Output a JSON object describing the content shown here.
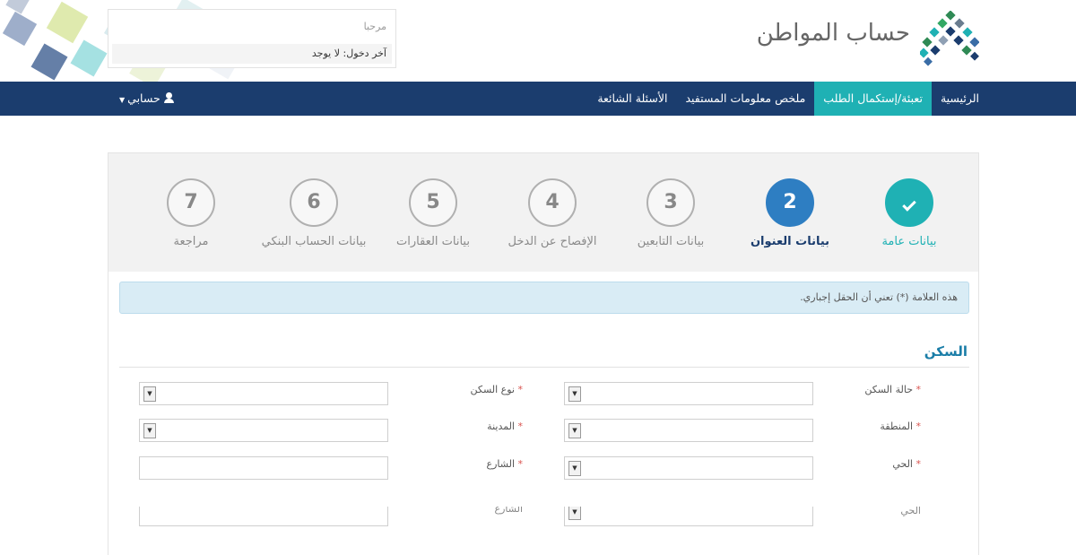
{
  "header": {
    "welcome": "مرحبا",
    "last_login": "آخر دخول: لا يوجد",
    "brand": "حساب المواطن"
  },
  "nav": {
    "items": [
      {
        "label": "الرئيسية",
        "active": false
      },
      {
        "label": "تعبئة/إستكمال الطلب",
        "active": true
      },
      {
        "label": "ملخص معلومات المستفيد",
        "active": false
      },
      {
        "label": "الأسئلة الشائعة",
        "active": false
      }
    ],
    "account_label": "حسابي",
    "account_caret": "▼"
  },
  "steps": [
    {
      "number": "",
      "label": "بيانات عامة",
      "state": "done"
    },
    {
      "number": "2",
      "label": "بيانات العنوان",
      "state": "current"
    },
    {
      "number": "3",
      "label": "بيانات التابعين",
      "state": "pending"
    },
    {
      "number": "4",
      "label": "الإفصاح عن الدخل",
      "state": "pending"
    },
    {
      "number": "5",
      "label": "بيانات العقارات",
      "state": "pending"
    },
    {
      "number": "6",
      "label": "بيانات الحساب البنكي",
      "state": "pending"
    },
    {
      "number": "7",
      "label": "مراجعة",
      "state": "pending"
    }
  ],
  "alert": "هذه العلامة (*) تعني أن الحقل إجباري.",
  "section": {
    "title": "السكن",
    "fields": {
      "housing_status": {
        "label": "حالة السكن",
        "required": "*"
      },
      "housing_type": {
        "label": "نوع السكن",
        "required": "*"
      },
      "region": {
        "label": "المنطقة",
        "required": "*"
      },
      "city": {
        "label": "المدينة",
        "required": "*"
      },
      "district": {
        "label": "الحي",
        "required": "*"
      },
      "street": {
        "label": "الشارع",
        "required": "*"
      },
      "district_repeat": {
        "label": "الحي"
      },
      "street_repeat": {
        "label": "الشارع"
      }
    },
    "dropdown_arrow": "▼"
  },
  "colors": {
    "navbar": "#1b3d6e",
    "active_nav": "#1fb1b4",
    "step_done": "#1fb1b4",
    "step_current": "#2e7ec2",
    "section_title": "#1b7ea8",
    "alert_bg": "#d9ecf5"
  },
  "icons": [
    "user-icon",
    "check-icon",
    "dropdown-arrow-icon",
    "caret-down-icon"
  ]
}
